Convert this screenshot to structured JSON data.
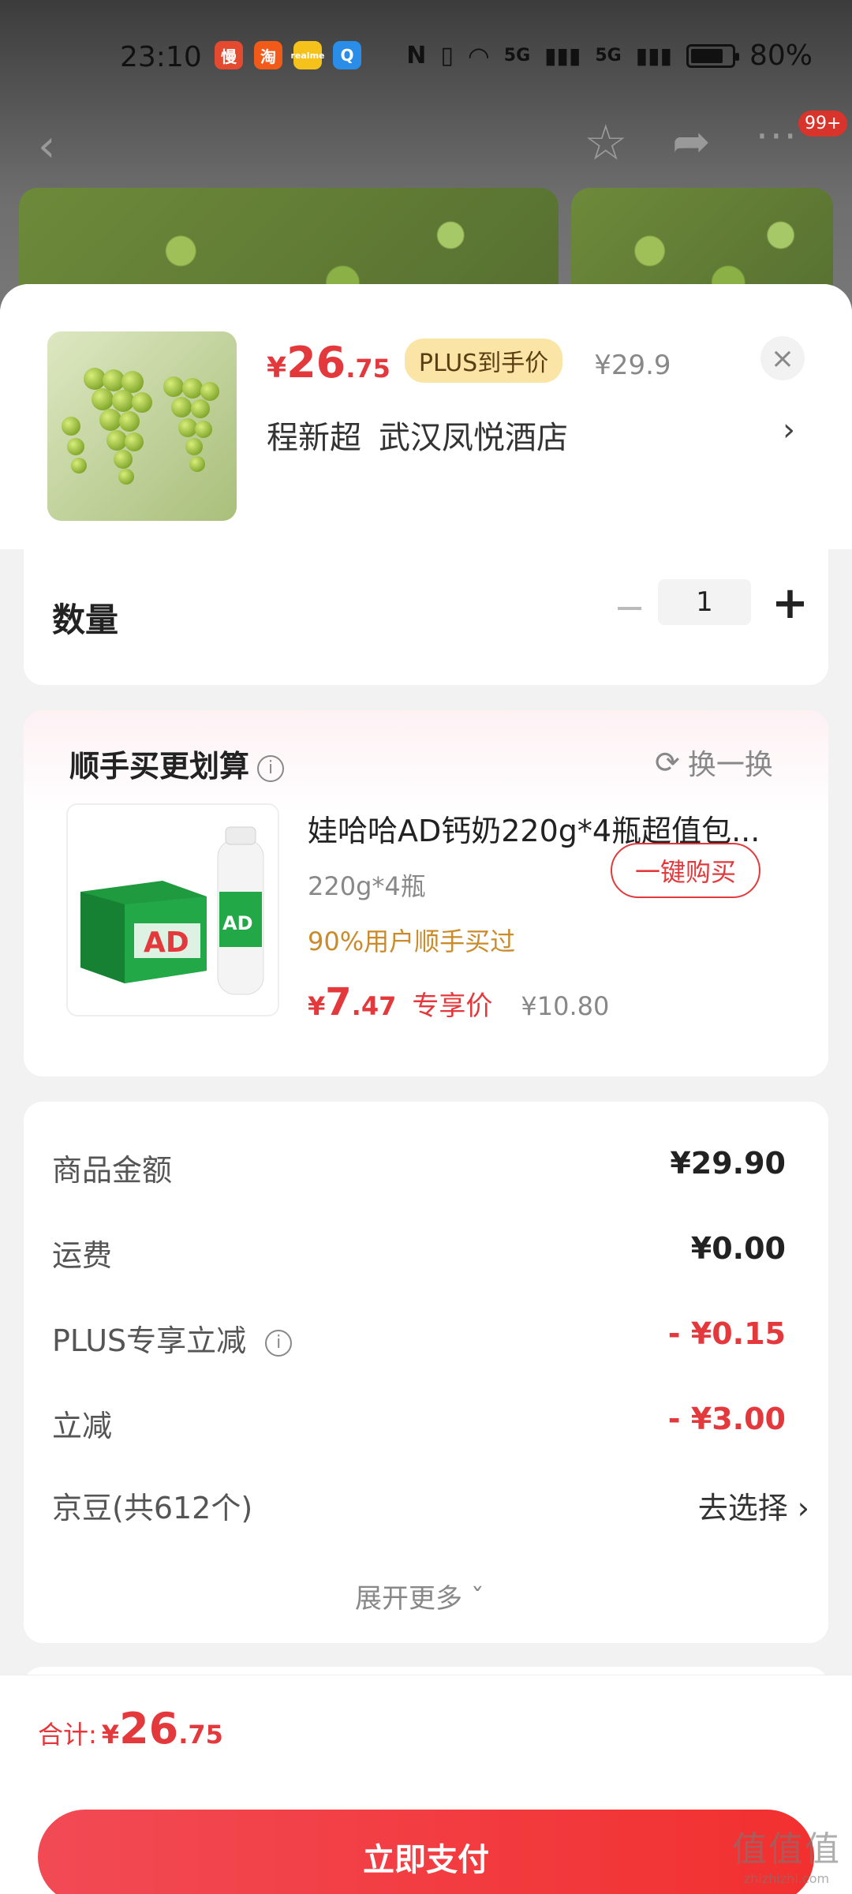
{
  "status_bar": {
    "time": "23:10",
    "apps": [
      {
        "icon": "manman-app-icon",
        "glyph": "慢",
        "color": "#e34a2f"
      },
      {
        "icon": "taobao-app-icon",
        "glyph": "淘",
        "color": "#f25a1a"
      },
      {
        "icon": "realme-app-icon",
        "glyph": "realme",
        "color": "#f4c21a"
      },
      {
        "icon": "search-app-icon",
        "glyph": "Q",
        "color": "#2a8de8"
      }
    ],
    "network": "5G",
    "battery_pct": 80,
    "battery_label": "80%"
  },
  "nav": {
    "back_glyph": "‹",
    "badge": "99+"
  },
  "product": {
    "price_yen": "¥",
    "price_int": "26",
    "price_dec": ".75",
    "plus_label": "PLUS到手价",
    "orig_price": "¥29.9",
    "close_glyph": "×",
    "address_name": "程新超",
    "address_place": "武汉凤悦酒店",
    "address_arrow": "›"
  },
  "quantity": {
    "label": "数量",
    "minus": "−",
    "value": "1",
    "plus": "+"
  },
  "upsell": {
    "title": "顺手买更划算",
    "info_glyph": "i",
    "refresh_label": "换一换",
    "name": "娃哈哈AD钙奶220g*4瓶超值包...",
    "spec": "220g*4瓶",
    "bought": "90%用户顺手买过",
    "price_yen": "¥",
    "price_int": "7",
    "price_dec": ".47",
    "price_tag": "专享价",
    "orig_price": "¥10.80",
    "buy_label": "一键购买"
  },
  "cost": {
    "rows": [
      {
        "label": "商品金额",
        "value": "¥29.90"
      },
      {
        "label": "运费",
        "value": "¥0.00"
      },
      {
        "label": "PLUS专享立减",
        "value": "- ¥0.15"
      },
      {
        "label": "立减",
        "value": "- ¥3.00"
      },
      {
        "label": "京豆(共612个)",
        "value": "去选择 ›"
      }
    ],
    "expand_label": "展开更多 ˇ"
  },
  "bottom": {
    "total_label": "合计:",
    "total_yen": "¥",
    "total_int": "26",
    "total_dec": ".75",
    "pay_label": "立即支付"
  },
  "watermark": {
    "main": "值值值",
    "sub": "zhizhizhi.com"
  },
  "colors": {
    "accent_red": "#e4393c",
    "plus_gold": "#fbe5a6",
    "bought_orange": "#c98b2b"
  }
}
